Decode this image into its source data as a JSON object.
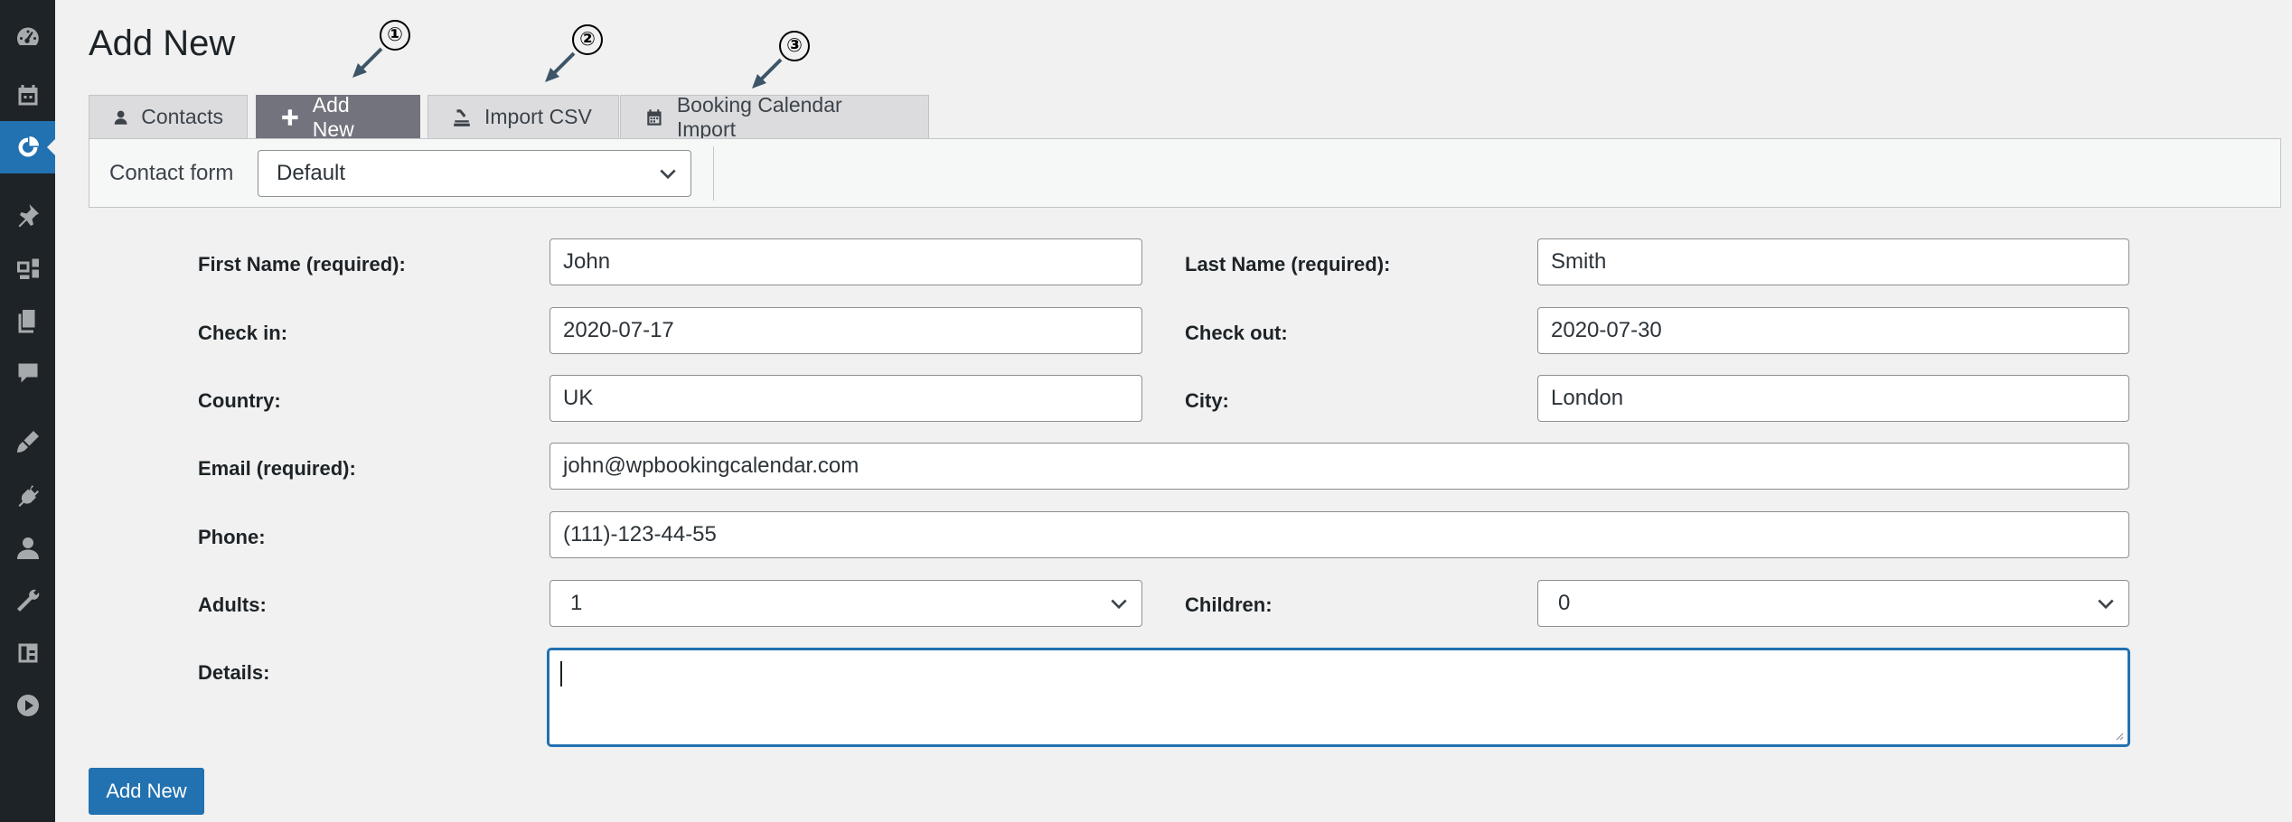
{
  "sidebar": {
    "items": [
      {
        "icon": "dashboard-icon"
      },
      {
        "icon": "calendar-icon"
      },
      {
        "icon": "contacts-plugin-icon",
        "active": true
      },
      {
        "icon": "pin-icon"
      },
      {
        "icon": "media-icon"
      },
      {
        "icon": "pages-icon"
      },
      {
        "icon": "comments-icon"
      },
      {
        "icon": "appearance-icon"
      },
      {
        "icon": "plugins-icon"
      },
      {
        "icon": "users-icon"
      },
      {
        "icon": "tools-icon"
      },
      {
        "icon": "settings-icon"
      },
      {
        "icon": "play-icon"
      }
    ]
  },
  "page": {
    "title": "Add New"
  },
  "annotations": [
    "①",
    "②",
    "③"
  ],
  "tabs": [
    {
      "label": "Contacts",
      "icon": "user-icon",
      "active": false
    },
    {
      "label": "Add New",
      "icon": "plus-icon",
      "active": true
    },
    {
      "label": "Import CSV",
      "icon": "import-icon",
      "active": false
    },
    {
      "label": "Booking Calendar Import",
      "icon": "calendar-icon",
      "active": false
    }
  ],
  "toolbar": {
    "contact_form_label": "Contact form",
    "contact_form_value": "Default"
  },
  "form": {
    "first_name": {
      "label": "First Name (required):",
      "value": "John"
    },
    "last_name": {
      "label": "Last Name (required):",
      "value": "Smith"
    },
    "check_in": {
      "label": "Check in:",
      "value": "2020-07-17"
    },
    "check_out": {
      "label": "Check out:",
      "value": "2020-07-30"
    },
    "country": {
      "label": "Country:",
      "value": "UK"
    },
    "city": {
      "label": "City:",
      "value": "London"
    },
    "email": {
      "label": "Email (required):",
      "value": "john@wpbookingcalendar.com"
    },
    "phone": {
      "label": "Phone:",
      "value": "(111)-123-44-55"
    },
    "adults": {
      "label": "Adults:",
      "value": "1"
    },
    "children": {
      "label": "Children:",
      "value": "0"
    },
    "details": {
      "label": "Details:",
      "value": ""
    },
    "submit_label": "Add New"
  },
  "colors": {
    "accent": "#2271b1",
    "sidebar_bg": "#1d2327",
    "active_tab": "#73737e",
    "arrow": "#3d5567"
  }
}
